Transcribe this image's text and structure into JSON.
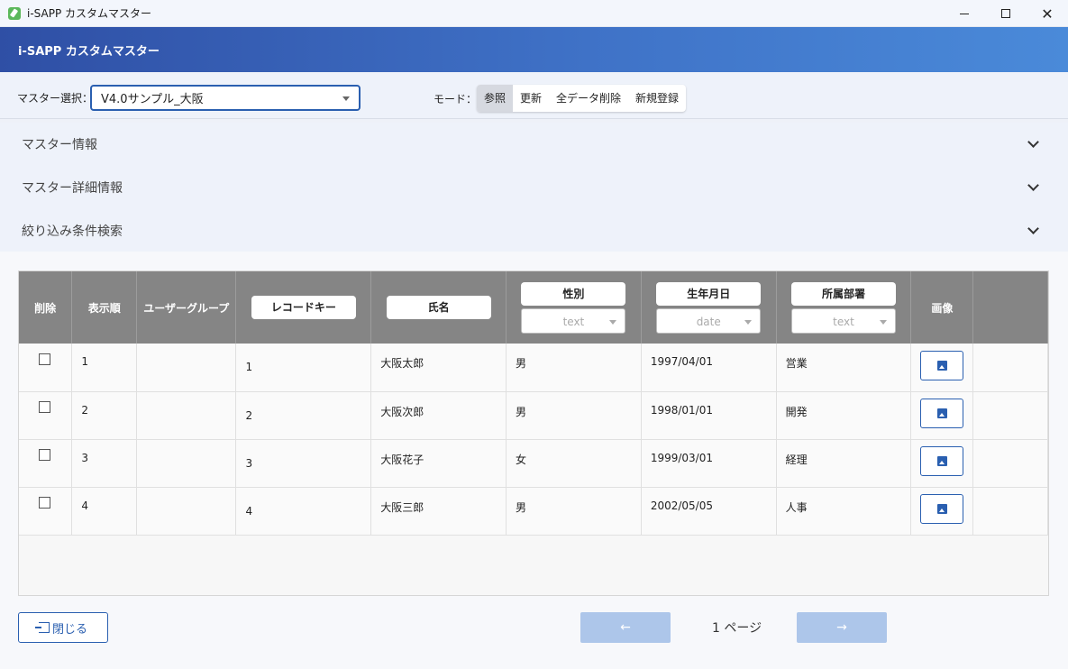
{
  "window": {
    "title": "i-SAPP カスタムマスター",
    "controls": {
      "minimize": "—",
      "maximize": "☐",
      "close": "✕"
    }
  },
  "header": {
    "title": "i-SAPP カスタムマスター"
  },
  "toolbar": {
    "master_label": "マスター選択：",
    "master_value": "V4.0サンプル_大阪",
    "mode_label": "モード：",
    "modes": [
      "参照",
      "更新",
      "全データ削除",
      "新規登録"
    ],
    "active_mode": "参照"
  },
  "accordions": [
    {
      "label": "マスター情報"
    },
    {
      "label": "マスター詳細情報"
    },
    {
      "label": "絞り込み条件検索"
    }
  ],
  "table": {
    "headers": {
      "delete": "削除",
      "order": "表示順",
      "user_group": "ユーザーグループ",
      "record_key": "レコードキー",
      "name": "氏名",
      "gender": "性別",
      "birthdate": "生年月日",
      "department": "所属部署",
      "image": "画像"
    },
    "filters": {
      "gender": "text",
      "birthdate": "date",
      "department": "text"
    },
    "rows": [
      {
        "order": "1",
        "user_group": "",
        "record_key": "1",
        "name": "大阪太郎",
        "gender": "男",
        "birthdate": "1997/04/01",
        "department": "営業"
      },
      {
        "order": "2",
        "user_group": "",
        "record_key": "2",
        "name": "大阪次郎",
        "gender": "男",
        "birthdate": "1998/01/01",
        "department": "開発"
      },
      {
        "order": "3",
        "user_group": "",
        "record_key": "3",
        "name": "大阪花子",
        "gender": "女",
        "birthdate": "1999/03/01",
        "department": "経理"
      },
      {
        "order": "4",
        "user_group": "",
        "record_key": "4",
        "name": "大阪三郎",
        "gender": "男",
        "birthdate": "2002/05/05",
        "department": "人事"
      }
    ]
  },
  "footer": {
    "close_label": "閉じる",
    "prev_label": "←",
    "next_label": "→",
    "page_info": "1 ページ"
  },
  "colors": {
    "accent": "#2a5fb0",
    "header_gradient_start": "#2f4fa5",
    "header_gradient_end": "#4a8ad9",
    "table_header": "#858585",
    "pager_disabled": "#adc6ea"
  }
}
